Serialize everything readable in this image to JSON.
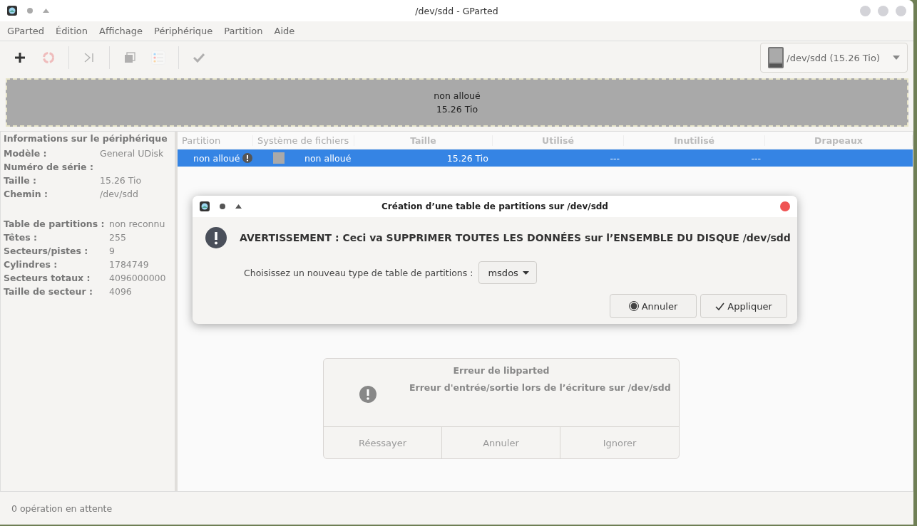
{
  "window": {
    "title": "/dev/sdd - GParted"
  },
  "menu": [
    "GParted",
    "Édition",
    "Affichage",
    "Périphérique",
    "Partition",
    "Aide"
  ],
  "toolbar": [
    {
      "kind": "new",
      "disabled": false
    },
    {
      "kind": "delete",
      "disabled": true
    },
    {
      "kind": "separator"
    },
    {
      "kind": "resize",
      "disabled": true
    },
    {
      "kind": "separator"
    },
    {
      "kind": "copy",
      "disabled": true
    },
    {
      "kind": "paste",
      "disabled": true
    },
    {
      "kind": "separator"
    },
    {
      "kind": "apply",
      "disabled": true
    }
  ],
  "device_selector": {
    "value": "/dev/sdd (15.26 Tio)"
  },
  "disk_map": {
    "label": "non alloué",
    "size": "15.26 Tio"
  },
  "device_info": {
    "title": "Informations sur le périphérique",
    "groups": [
      [
        {
          "label": "Modèle :",
          "value": "General UDisk"
        },
        {
          "label": "Numéro de série :"
        },
        {
          "label": "Taille :",
          "value": "15.26 Tio"
        },
        {
          "label": "Chemin :",
          "value": "/dev/sdd"
        }
      ],
      [
        {
          "label": "Table de partitions :",
          "value": "non reconnu"
        },
        {
          "label": "Têtes :",
          "value": "255"
        },
        {
          "label": "Secteurs/pistes :",
          "value": "9"
        },
        {
          "label": "Cylindres :",
          "value": "1784749"
        },
        {
          "label": "Secteurs totaux :",
          "value": "4096000000"
        },
        {
          "label": "Taille de secteur :",
          "value": "4096"
        }
      ]
    ]
  },
  "table": {
    "columns": [
      "Partition",
      "Système de fichiers",
      "Taille",
      "Utilisé",
      "Inutilisé",
      "Drapeaux"
    ],
    "rows": [
      {
        "selected": true,
        "partition": "non alloué",
        "warning": true,
        "filesystem": "non alloué",
        "size": "15.26 Tio",
        "used": "---",
        "unused": "---"
      }
    ]
  },
  "create_dialog": {
    "title": "Création d’une table de partitions sur /dev/sdd",
    "warning": "AVERTISSEMENT : Ceci va SUPPRIMER TOUTES LES DONNÉES sur l’ENSEMBLE DU DISQUE /dev/sdd",
    "prompt": "Choisissez un nouveau type de table de partitions :",
    "table_type": "msdos",
    "buttons": [
      {
        "kind": "cancel",
        "label": "Annuler"
      },
      {
        "kind": "apply",
        "label": "Appliquer"
      }
    ]
  },
  "error_dialog": {
    "title": "Erreur de libparted",
    "message": "Erreur d'entrée/sortie lors de l’écriture sur /dev/sdd",
    "buttons": [
      "Réessayer",
      "Annuler",
      "Ignorer"
    ]
  },
  "status_bar": "0 opération en attente"
}
